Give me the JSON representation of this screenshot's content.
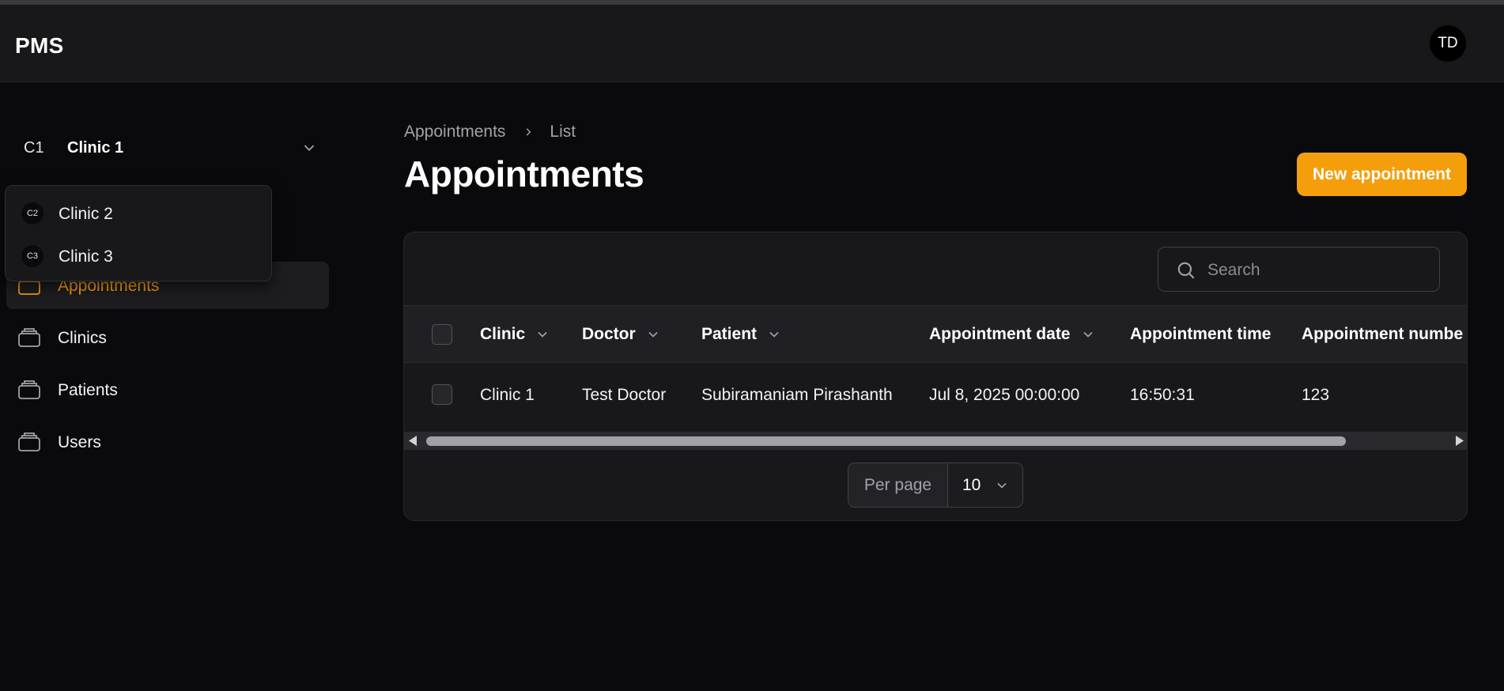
{
  "app": {
    "brand": "PMS",
    "user_initials": "TD"
  },
  "tenant": {
    "abbr": "C1",
    "name": "Clinic 1"
  },
  "tenant_menu": [
    {
      "badge": "C2",
      "label": "Clinic 2"
    },
    {
      "badge": "C3",
      "label": "Clinic 3"
    }
  ],
  "nav": [
    {
      "label": "Appointments",
      "active": true
    },
    {
      "label": "Clinics"
    },
    {
      "label": "Patients"
    },
    {
      "label": "Users"
    }
  ],
  "breadcrumb": {
    "parent": "Appointments",
    "current": "List"
  },
  "page": {
    "title": "Appointments",
    "new_button": "New appointment"
  },
  "search": {
    "placeholder": "Search"
  },
  "table": {
    "columns": [
      "Clinic",
      "Doctor",
      "Patient",
      "Appointment date",
      "Appointment time",
      "Appointment numbe"
    ],
    "rows": [
      [
        "Clinic 1",
        "Test Doctor",
        "Subiramaniam Pirashanth",
        "Jul 8, 2025 00:00:00",
        "16:50:31",
        "123"
      ]
    ]
  },
  "pagination": {
    "per_page_label": "Per page",
    "per_page_value": "10"
  },
  "colors": {
    "accent": "#f59e0b",
    "background": "#0a0a0c",
    "surface": "#18181b"
  }
}
